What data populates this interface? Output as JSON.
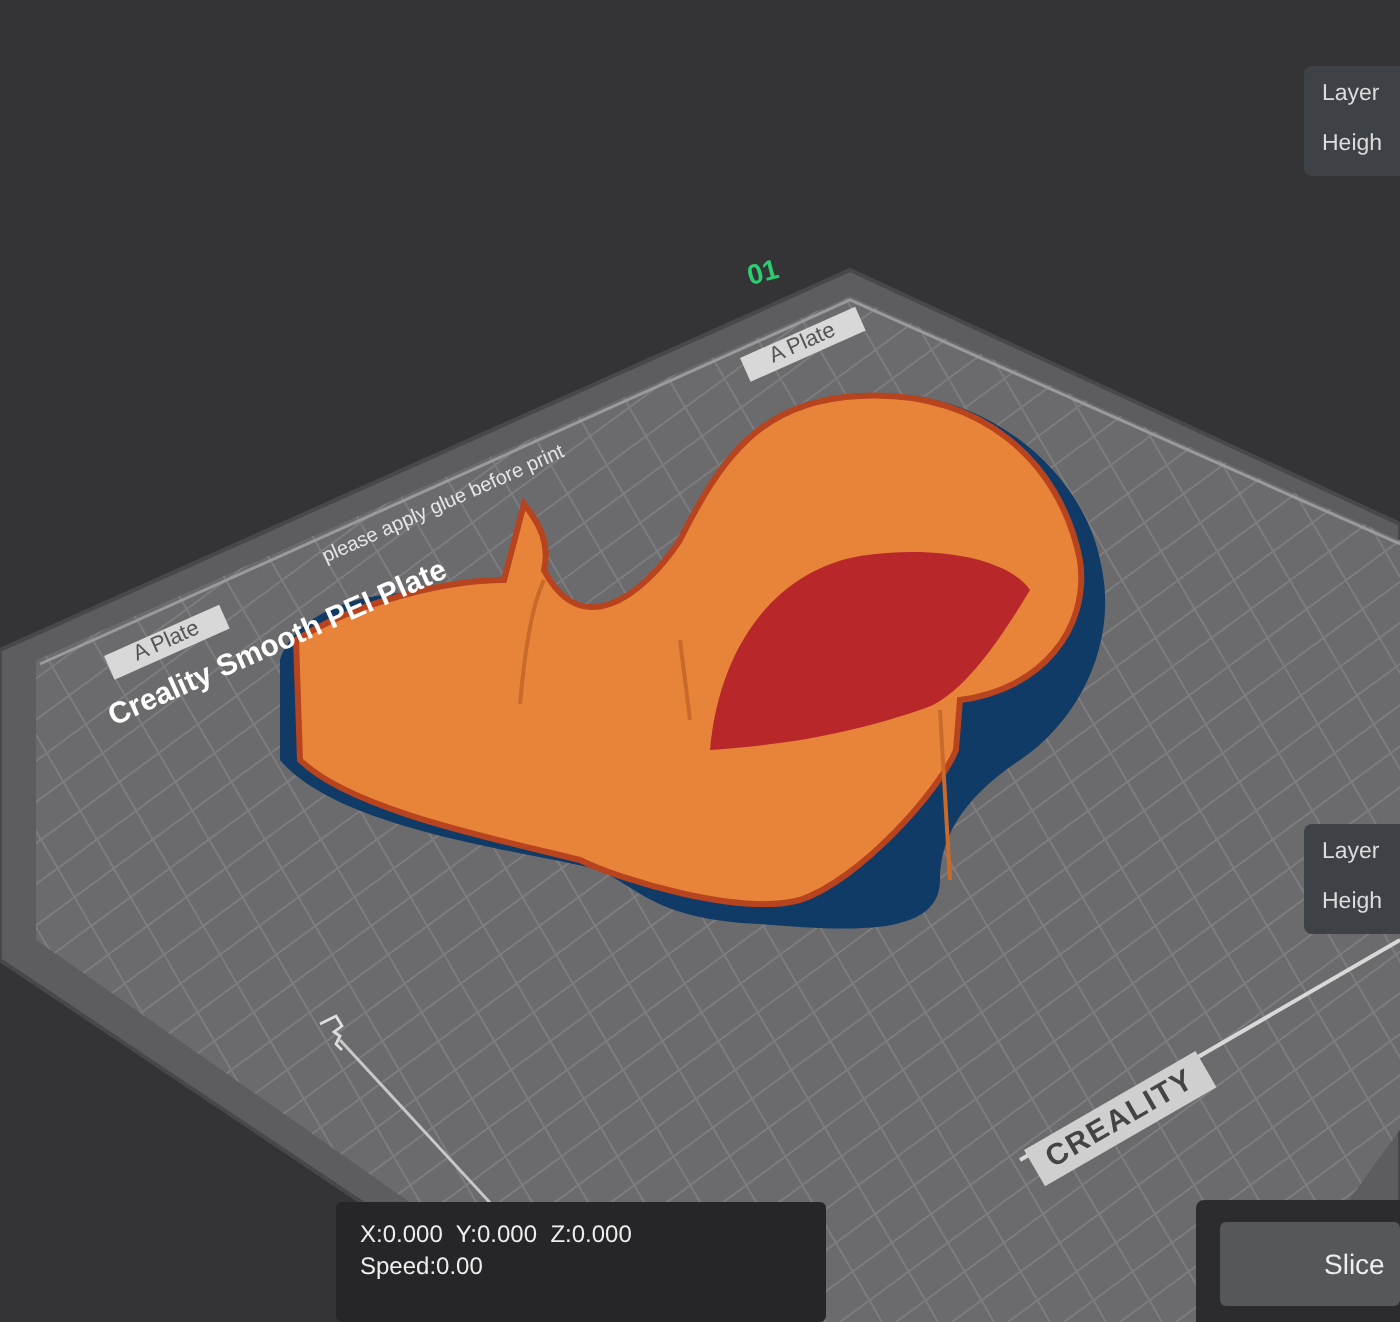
{
  "plate": {
    "number": "01",
    "tab_labels": [
      "A Plate",
      "A Plate"
    ],
    "notice": "please apply glue before print",
    "name": "Creality Smooth PEI Plate",
    "brand": "CREALITY"
  },
  "info_panels": [
    {
      "lines": [
        "Layer",
        "Heigh"
      ]
    },
    {
      "lines": [
        "Layer",
        "Heigh"
      ]
    }
  ],
  "coordinates": {
    "position": "X:0.000  Y:0.000  Z:0.000",
    "speed": "Speed:0.00"
  },
  "slice_button": {
    "label": "Slice"
  }
}
